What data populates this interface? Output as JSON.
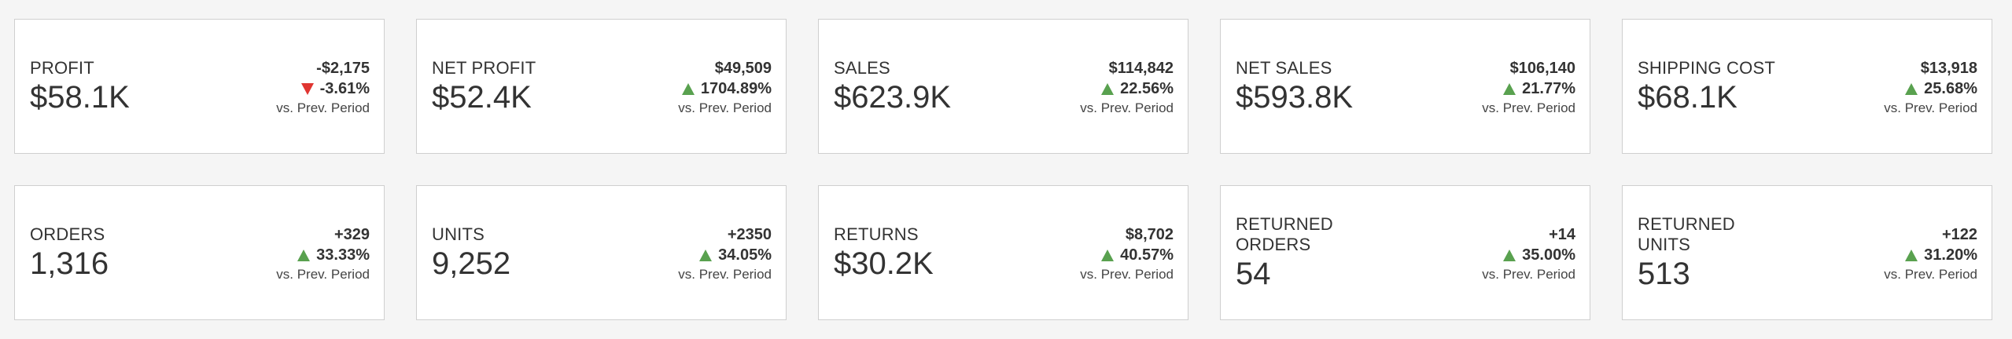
{
  "colors": {
    "up": "#59a14f",
    "down": "#e03531",
    "background": "#f5f5f5",
    "card": "#ffffff",
    "text": "#333333"
  },
  "cards": [
    {
      "title": "PROFIT",
      "value": "$58.1K",
      "delta": "-$2,175",
      "pct": "-3.61%",
      "direction": "down",
      "vs": "vs. Prev. Period"
    },
    {
      "title": "NET PROFIT",
      "value": "$52.4K",
      "delta": "$49,509",
      "pct": "1704.89%",
      "direction": "up",
      "vs": "vs. Prev. Period"
    },
    {
      "title": "SALES",
      "value": "$623.9K",
      "delta": "$114,842",
      "pct": "22.56%",
      "direction": "up",
      "vs": "vs. Prev. Period"
    },
    {
      "title": "NET SALES",
      "value": "$593.8K",
      "delta": "$106,140",
      "pct": "21.77%",
      "direction": "up",
      "vs": "vs. Prev. Period"
    },
    {
      "title": "SHIPPING COST",
      "value": "$68.1K",
      "delta": "$13,918",
      "pct": "25.68%",
      "direction": "up",
      "vs": "vs. Prev. Period"
    },
    {
      "title": "ORDERS",
      "value": "1,316",
      "delta": "+329",
      "pct": "33.33%",
      "direction": "up",
      "vs": "vs. Prev. Period"
    },
    {
      "title": "UNITS",
      "value": "9,252",
      "delta": "+2350",
      "pct": "34.05%",
      "direction": "up",
      "vs": "vs. Prev. Period"
    },
    {
      "title": "RETURNS",
      "value": "$30.2K",
      "delta": "$8,702",
      "pct": "40.57%",
      "direction": "up",
      "vs": "vs. Prev. Period"
    },
    {
      "title": "RETURNED\nORDERS",
      "value": "54",
      "delta": "+14",
      "pct": "35.00%",
      "direction": "up",
      "vs": "vs. Prev. Period"
    },
    {
      "title": "RETURNED\nUNITS",
      "value": "513",
      "delta": "+122",
      "pct": "31.20%",
      "direction": "up",
      "vs": "vs. Prev. Period"
    }
  ]
}
